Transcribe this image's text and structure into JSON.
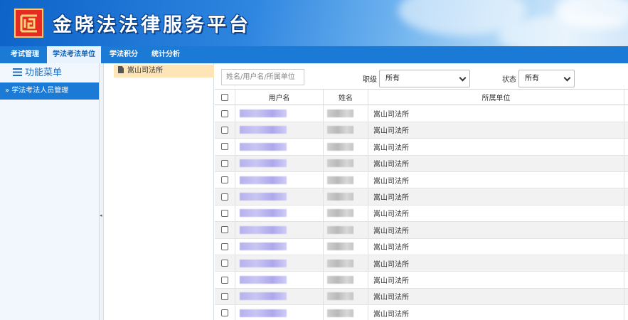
{
  "banner": {
    "title": "金晓法法律服务平台",
    "logo_glyph": "logo-icon"
  },
  "nav": {
    "items": [
      {
        "label": "考试管理",
        "active": false
      },
      {
        "label": "学法考法单位",
        "active": true
      },
      {
        "label": "学法积分",
        "active": false
      },
      {
        "label": "统计分析",
        "active": false
      }
    ]
  },
  "sidebar": {
    "header": "功能菜单",
    "items": [
      {
        "label": "» 学法考法人员管理",
        "active": true
      }
    ]
  },
  "tree": {
    "node": "嵩山司法所"
  },
  "filters": {
    "search_placeholder": "姓名/用户名/所属单位",
    "level_label": "职级",
    "level_value": "所有",
    "status_label": "状态",
    "status_value": "所有"
  },
  "table": {
    "columns": [
      "用户名",
      "姓名",
      "所属单位"
    ],
    "rows": [
      {
        "unit": "嵩山司法所"
      },
      {
        "unit": "嵩山司法所"
      },
      {
        "unit": "嵩山司法所"
      },
      {
        "unit": "嵩山司法所"
      },
      {
        "unit": "嵩山司法所"
      },
      {
        "unit": "嵩山司法所"
      },
      {
        "unit": "嵩山司法所"
      },
      {
        "unit": "嵩山司法所"
      },
      {
        "unit": "嵩山司法所"
      },
      {
        "unit": "嵩山司法所"
      },
      {
        "unit": "嵩山司法所"
      },
      {
        "unit": "嵩山司法所"
      },
      {
        "unit": "嵩山司法所"
      }
    ]
  },
  "colors": {
    "brand_blue": "#1a7ad6",
    "logo_red": "#e52b22",
    "tree_selected": "#fde5b8"
  }
}
